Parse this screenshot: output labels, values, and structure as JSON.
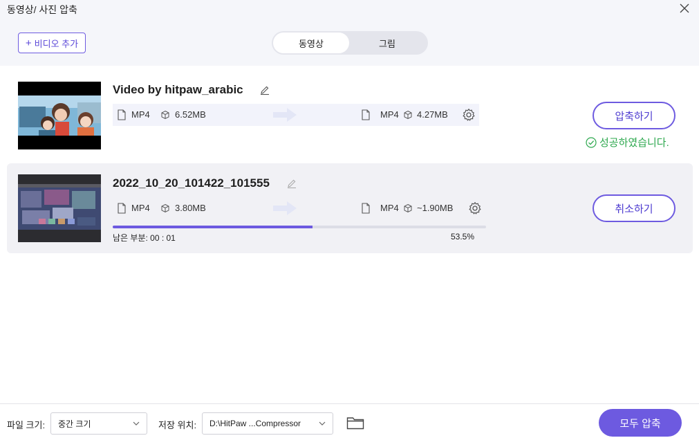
{
  "window": {
    "title": "동영상/ 사진 압축"
  },
  "toolbar": {
    "add_video_label": "비디오 추가"
  },
  "tabs": [
    {
      "label": "동영상",
      "active": true
    },
    {
      "label": "그림",
      "active": false
    }
  ],
  "files": [
    {
      "title": "Video by hitpaw_arabic",
      "source": {
        "format": "MP4",
        "size": "6.52MB"
      },
      "target": {
        "format": "MP4",
        "size": "4.27MB"
      },
      "action_label": "압축하기",
      "status": "성공하였습니다."
    },
    {
      "title": "2022_10_20_101422_101555",
      "source": {
        "format": "MP4",
        "size": "3.80MB"
      },
      "target": {
        "format": "MP4",
        "size": "~1.90MB"
      },
      "action_label": "취소하기",
      "remaining": "남은 부분: 00 : 01",
      "progress_label": "53.5%",
      "progress_value": 0.535
    }
  ],
  "footer": {
    "file_size_label": "파일 크기:",
    "file_size_value": "중간 크기",
    "save_location_label": "저장 위치:",
    "save_location_value": "D:\\HitPaw ...Compressor",
    "compress_all_label": "모두 압축"
  },
  "colors": {
    "accent": "#6d5ae0",
    "success": "#2da84e"
  }
}
